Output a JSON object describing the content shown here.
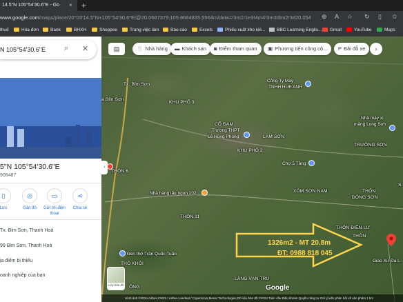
{
  "browser": {
    "tab_title": "14.5\"N 105°54'30.6\"E - Go",
    "tab_close": "×",
    "new_tab": "+",
    "url_domain": "www.google.com",
    "url_rest": "/maps/place/20°03'14.5\"N+105°54'30.6\"E/@20.0687379,105.8684835,5564m/data=!3m1!1e3!4m4!3m3!8m2!3d20.0540",
    "bookmarks": [
      "thuế",
      "Hóa đơn",
      "Bank",
      "BHXH",
      "Shoppee",
      "Trang việc làm",
      "Báo cáo",
      "Excels",
      "Phiếu xuất kho kiê...",
      "BBC Learning Englis...",
      "Gmail",
      "YouTube",
      "Maps"
    ]
  },
  "panel": {
    "search_value": "N 105°54'30.6\"E",
    "search_icon": "search-icon",
    "close_icon": "close-icon",
    "title": "5\"N 105°54'30.6\"E",
    "subtitle": "908487",
    "actions": [
      {
        "label": "Lưu",
        "icon": "bookmark-icon"
      },
      {
        "label": "Gần đó",
        "icon": "nearby-icon"
      },
      {
        "label": "Gửi tới điện thoại",
        "icon": "phone-icon"
      },
      {
        "label": "Chia sẻ",
        "icon": "share-icon"
      }
    ],
    "info_rows": [
      "Tx. Bỉm Sơn, Thanh Hoá",
      "99 Bỉm Sơn, Thanh Hoá",
      "ịa điểm bị thiếu",
      "oanh nghiệp của bạn"
    ]
  },
  "map": {
    "chips": [
      {
        "label": "Nhà hàng",
        "icon": "restaurant-icon"
      },
      {
        "label": "Khách sạn",
        "icon": "hotel-icon"
      },
      {
        "label": "Điểm tham quan",
        "icon": "camera-icon"
      },
      {
        "label": "Phương tiện công cộ...",
        "icon": "transit-icon"
      },
      {
        "label": "Bãi đỗ xe",
        "icon": "parking-icon"
      }
    ],
    "labels": [
      "Tx. Bỉm Sơn",
      "a Bỉm Sơn",
      "KHU PHỐ 3",
      "Công Ty May",
      "TNHH HUE ANH",
      "CỔ ĐAM",
      "Trường THPT",
      "Lê Hồng Phong",
      "LAM SƠN",
      "KHU PHỐ 2",
      "Nhà máy xi",
      "măng Long Sơn",
      "TRƯỜNG SƠN",
      "Chợ 5 Tầng",
      "Nhà hàng lẩu ngon 102",
      "THÔN 6",
      "XÓM SƠN NAM",
      "THÔN",
      "ĐÔNG SƠN",
      "THÔN 11",
      "THÔN ĐIỀN LƯ",
      "THÔN",
      "Đền thờ Trần Quốc Tuấn",
      "THÔ KHÔI",
      "Giáo Xứ Đa L",
      "LÀNG VẠN TRU",
      "ỒNG",
      "S"
    ],
    "annotation_line1": "1326m2 - MT 20.8m",
    "annotation_line2": "ĐT: 0988 818 045",
    "google_logo": "Google",
    "layer_label": "Lớp bản đồ",
    "footer": "Hình ảnh ©2024 Airbus,CNES / Airbus,Landsat / Copernicus,Maxar Technologies,Dữ liệu bản đồ ©2024   Toàn cầu   Điều khoản   Quyền riêng tư   Gửi ý kiến phản hồi về sản phẩm   1 km",
    "colors": {
      "annotation": "#ffd54f",
      "pin": "#ea4335",
      "arrow_outline": "#ffd54f"
    }
  }
}
